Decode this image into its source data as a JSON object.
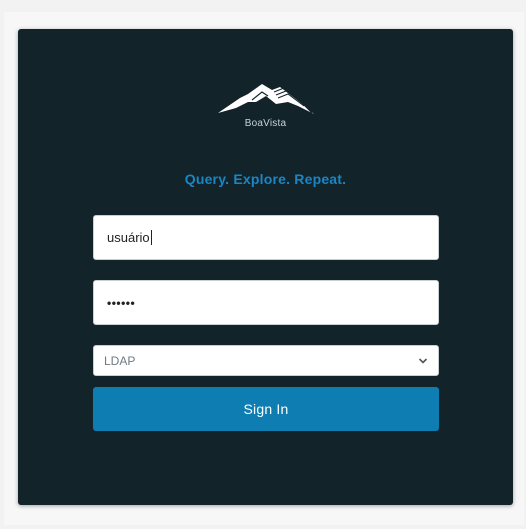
{
  "brand": {
    "name": "BoaVista",
    "logo_icon": "mountains-logo"
  },
  "tagline": "Query. Explore. Repeat.",
  "login": {
    "username_value": "usuário",
    "password_value": "••••••",
    "auth_method": {
      "selected": "LDAP",
      "icon": "chevron-down-icon"
    },
    "submit_label": "Sign In"
  },
  "colors": {
    "card_background": "#13232a",
    "accent": "#1a86c4",
    "button": "#0d7db2"
  }
}
